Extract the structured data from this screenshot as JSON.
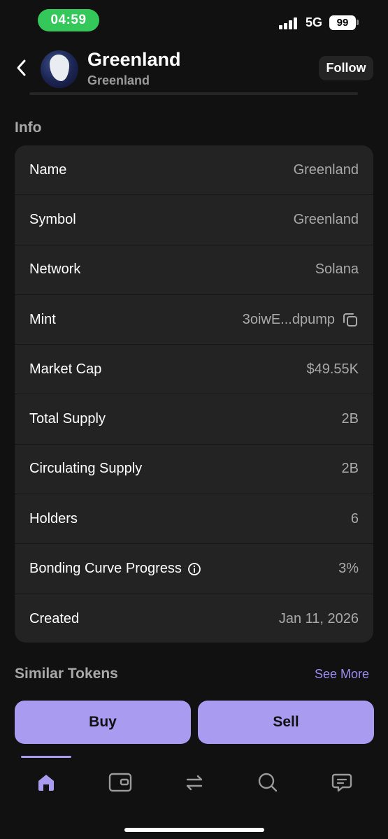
{
  "status_bar": {
    "time": "04:59",
    "network": "5G",
    "battery": "99"
  },
  "header": {
    "title": "Greenland",
    "subtitle": "Greenland",
    "follow_label": "Follow",
    "avatar_icon": "greenland-map-icon"
  },
  "info": {
    "title": "Info",
    "rows": [
      {
        "label": "Name",
        "value": "Greenland"
      },
      {
        "label": "Symbol",
        "value": "Greenland"
      },
      {
        "label": "Network",
        "value": "Solana"
      },
      {
        "label": "Mint",
        "value": "3oiwE...dpump"
      },
      {
        "label": "Market Cap",
        "value": "$49.55K"
      },
      {
        "label": "Total Supply",
        "value": "2B"
      },
      {
        "label": "Circulating Supply",
        "value": "2B"
      },
      {
        "label": "Holders",
        "value": "6"
      },
      {
        "label": "Bonding Curve Progress",
        "value": "3%"
      },
      {
        "label": "Created",
        "value": "Jan 11, 2026"
      }
    ]
  },
  "similar": {
    "title": "Similar Tokens",
    "see_more": "See More"
  },
  "actions": {
    "buy": "Buy",
    "sell": "Sell"
  },
  "nav": {
    "active": "home",
    "items": [
      "home-icon",
      "wallet-icon",
      "swap-icon",
      "search-icon",
      "chat-icon"
    ]
  },
  "colors": {
    "accent": "#a89bf0",
    "background": "#111111",
    "card": "#232323",
    "time_pill": "#34c759"
  }
}
